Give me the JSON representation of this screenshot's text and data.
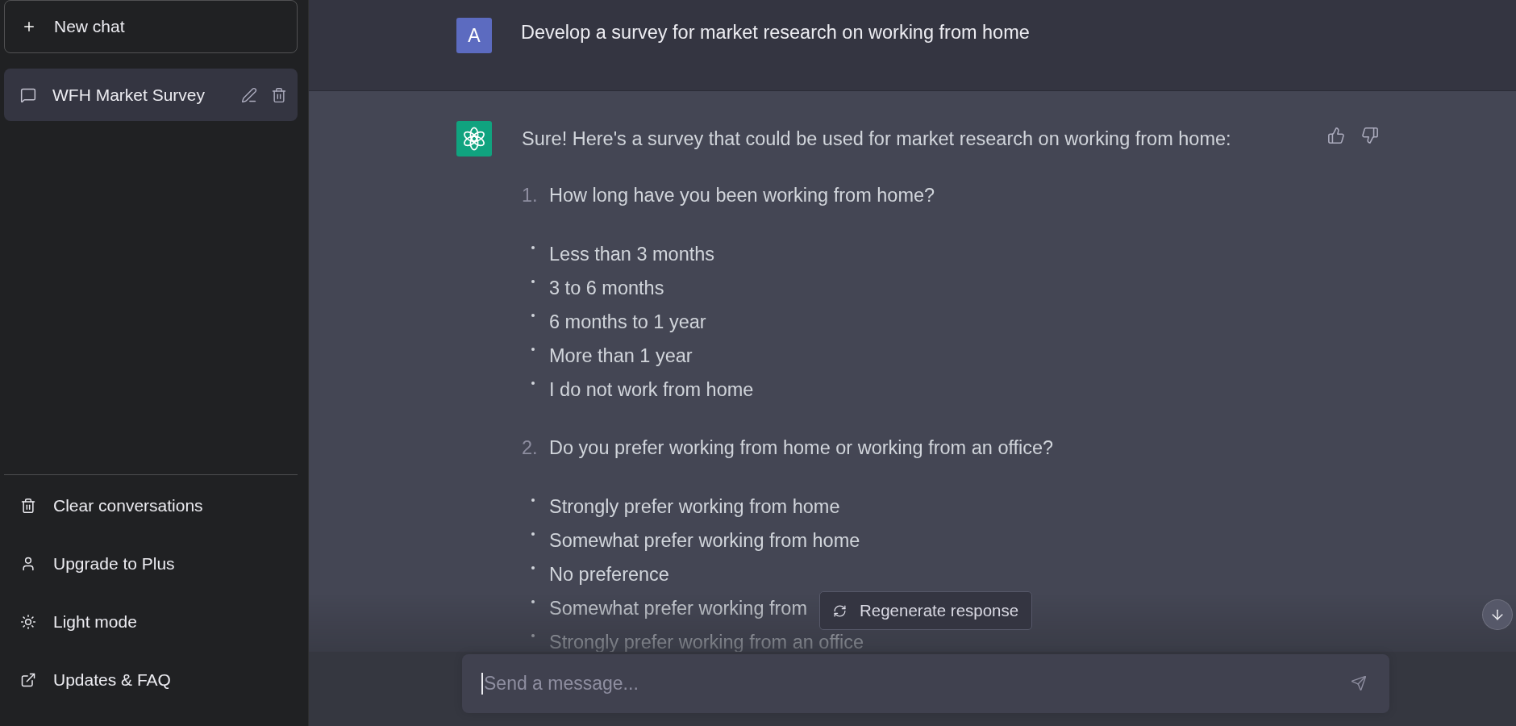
{
  "sidebar": {
    "new_chat_button": {
      "label": "New chat"
    },
    "conversations": [
      {
        "title": "WFH Market Survey",
        "selected": true
      }
    ],
    "menu": [
      {
        "label": "Clear conversations"
      },
      {
        "label": "Upgrade to Plus"
      },
      {
        "label": "Light mode"
      },
      {
        "label": "Updates & FAQ"
      }
    ]
  },
  "messages": [
    {
      "kind": "user",
      "avatar": "A",
      "text": "Develop a survey for market research on working from home"
    },
    {
      "kind": "assistant",
      "text": "Sure! Here's a survey that could be used for market research on working from home:",
      "questions": [
        {
          "number": "1.",
          "text": "How long have you been working from home?",
          "options": [
            "Less than 3 months",
            "3 to 6 months",
            "6 months to 1 year",
            "More than 1 year",
            "I do not work from home"
          ]
        },
        {
          "number": "2.",
          "text": "Do you prefer working from home or working from an office?",
          "options": [
            "Strongly prefer working from home",
            "Somewhat prefer working from home",
            "No preference",
            "Somewhat prefer working from",
            "Strongly prefer working from an office"
          ]
        }
      ]
    }
  ],
  "regenerate_button": {
    "label": "Regenerate response"
  },
  "composer": {
    "placeholder": "Send a message...",
    "focused": true
  }
}
